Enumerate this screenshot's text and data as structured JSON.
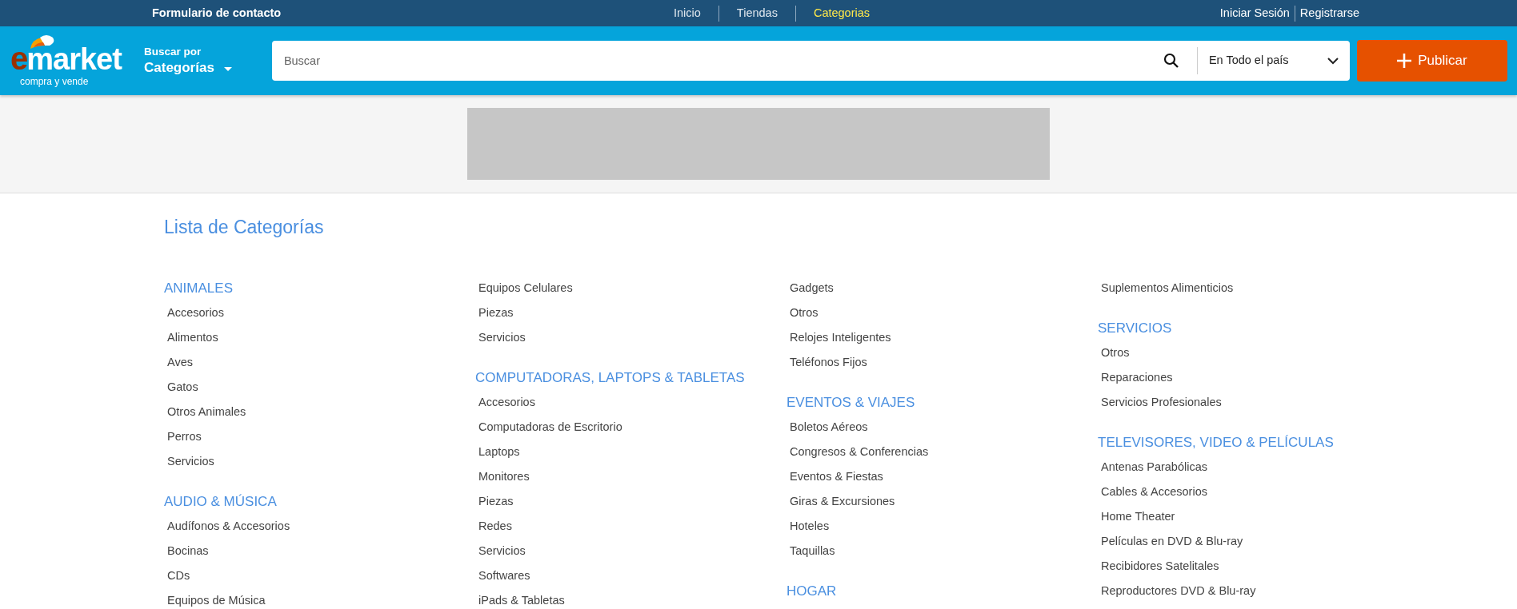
{
  "top_bar": {
    "contact_link": "Formulario de contacto",
    "nav": [
      {
        "label": "Inicio",
        "selected": false
      },
      {
        "label": "Tiendas",
        "selected": false
      },
      {
        "label": "Categorias",
        "selected": true
      }
    ],
    "account_links": [
      "Iniciar Sesión",
      "Registrarse"
    ]
  },
  "header": {
    "logo": {
      "initial": "e",
      "word": "market",
      "tagline": "compra y vende"
    },
    "category_picker": {
      "prefix": "Buscar por",
      "label": "Categorías"
    },
    "search": {
      "placeholder": "Buscar"
    },
    "location": {
      "value": "En Todo el país"
    },
    "publish_button": {
      "label": "Publicar"
    }
  },
  "page_title": "Lista de Categorías",
  "columns": [
    {
      "entries": [
        {
          "kind": "heading",
          "text": "ANIMALES"
        },
        {
          "kind": "item",
          "text": "Accesorios"
        },
        {
          "kind": "item",
          "text": "Alimentos"
        },
        {
          "kind": "item",
          "text": "Aves"
        },
        {
          "kind": "item",
          "text": "Gatos"
        },
        {
          "kind": "item",
          "text": "Otros Animales"
        },
        {
          "kind": "item",
          "text": "Perros"
        },
        {
          "kind": "item",
          "text": "Servicios"
        },
        {
          "kind": "heading",
          "text": "AUDIO & MÚSICA"
        },
        {
          "kind": "item",
          "text": "Audífonos & Accesorios"
        },
        {
          "kind": "item",
          "text": "Bocinas"
        },
        {
          "kind": "item",
          "text": "CDs"
        },
        {
          "kind": "item",
          "text": "Equipos de Música"
        }
      ]
    },
    {
      "entries": [
        {
          "kind": "item",
          "text": "Equipos Celulares"
        },
        {
          "kind": "item",
          "text": "Piezas"
        },
        {
          "kind": "item",
          "text": "Servicios"
        },
        {
          "kind": "heading",
          "text": "COMPUTADORAS, LAPTOPS & TABLETAS"
        },
        {
          "kind": "item",
          "text": "Accesorios"
        },
        {
          "kind": "item",
          "text": "Computadoras de Escritorio"
        },
        {
          "kind": "item",
          "text": "Laptops"
        },
        {
          "kind": "item",
          "text": "Monitores"
        },
        {
          "kind": "item",
          "text": "Piezas"
        },
        {
          "kind": "item",
          "text": "Redes"
        },
        {
          "kind": "item",
          "text": "Servicios"
        },
        {
          "kind": "item",
          "text": "Softwares"
        },
        {
          "kind": "item",
          "text": "iPads & Tabletas"
        }
      ]
    },
    {
      "entries": [
        {
          "kind": "item",
          "text": "Gadgets"
        },
        {
          "kind": "item",
          "text": "Otros"
        },
        {
          "kind": "item",
          "text": "Relojes Inteligentes"
        },
        {
          "kind": "item",
          "text": "Teléfonos Fijos"
        },
        {
          "kind": "heading",
          "text": "EVENTOS & VIAJES"
        },
        {
          "kind": "item",
          "text": "Boletos Aéreos"
        },
        {
          "kind": "item",
          "text": "Congresos & Conferencias"
        },
        {
          "kind": "item",
          "text": "Eventos & Fiestas"
        },
        {
          "kind": "item",
          "text": "Giras & Excursiones"
        },
        {
          "kind": "item",
          "text": "Hoteles"
        },
        {
          "kind": "item",
          "text": "Taquillas"
        },
        {
          "kind": "heading",
          "text": "HOGAR"
        }
      ]
    },
    {
      "entries": [
        {
          "kind": "item",
          "text": "Suplementos Alimenticios"
        },
        {
          "kind": "heading",
          "text": "SERVICIOS"
        },
        {
          "kind": "item",
          "text": "Otros"
        },
        {
          "kind": "item",
          "text": "Reparaciones"
        },
        {
          "kind": "item",
          "text": "Servicios Profesionales"
        },
        {
          "kind": "heading",
          "text": "TELEVISORES, VIDEO & PELÍCULAS"
        },
        {
          "kind": "item",
          "text": "Antenas Parabólicas"
        },
        {
          "kind": "item",
          "text": "Cables & Accesorios"
        },
        {
          "kind": "item",
          "text": "Home Theater"
        },
        {
          "kind": "item",
          "text": "Películas en DVD & Blu-ray"
        },
        {
          "kind": "item",
          "text": "Recibidores Satelitales"
        },
        {
          "kind": "item",
          "text": "Reproductores DVD & Blu-ray"
        }
      ]
    }
  ]
}
